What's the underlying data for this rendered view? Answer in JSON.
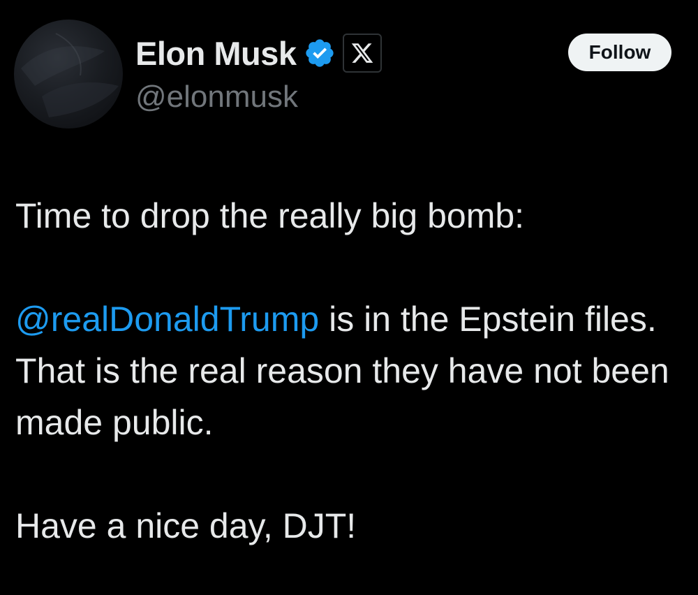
{
  "author": {
    "display_name": "Elon Musk",
    "handle": "@elonmusk",
    "verified_icon": "verified-badge-icon",
    "affiliate_icon": "x-logo-icon"
  },
  "actions": {
    "follow_label": "Follow"
  },
  "tweet": {
    "line1": "Time to drop the really big bomb:",
    "mention": "@realDonaldTrump",
    "para2_rest": " is in the Epstein files. That is the real reason they have not been made public.",
    "line3": "Have a nice day, DJT!"
  },
  "colors": {
    "background": "#000000",
    "text": "#e7e9ea",
    "secondary_text": "#71767b",
    "mention": "#1d9bf0",
    "verified_blue": "#1d9bf0",
    "follow_bg": "#eff3f4"
  }
}
